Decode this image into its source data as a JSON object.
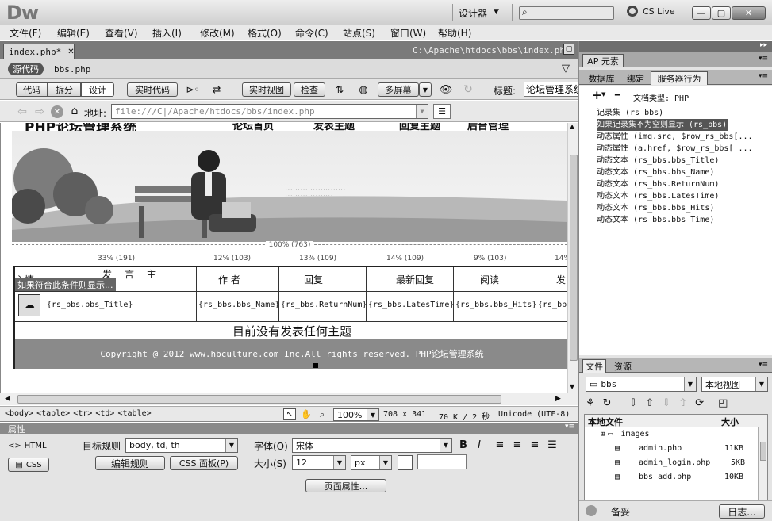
{
  "app": {
    "logo": "Dw",
    "workspace": "设计器",
    "brand": "CS Live"
  },
  "menu": [
    "文件(F)",
    "编辑(E)",
    "查看(V)",
    "插入(I)",
    "修改(M)",
    "格式(O)",
    "命令(C)",
    "站点(S)",
    "窗口(W)",
    "帮助(H)"
  ],
  "doc": {
    "tab_name": "index.php*",
    "path": "C:\\Apache\\htdocs\\bbs\\index.php",
    "source_label": "源代码",
    "related_file": "bbs.php",
    "address_label": "地址:",
    "address": "file:///C|/Apache/htdocs/bbs/index.php"
  },
  "toolbar": {
    "code": "代码",
    "split": "拆分",
    "design": "设计",
    "live_code": "实时代码",
    "live_view": "实时视图",
    "inspect": "检查",
    "multiscreen": "多屏幕",
    "title_label": "标题:",
    "title_value": "论坛管理系统"
  },
  "page": {
    "header_title": "PHP论坛管理系统",
    "nav": [
      "论坛首页",
      "发表主题",
      "回复主题",
      "后台管理"
    ],
    "width_label": "100% (763)",
    "col_widths": [
      "33% (191)",
      "12% (103)",
      "13% (109)",
      "14% (109)",
      "9% (103)",
      "14%"
    ],
    "header_cells": [
      "心情",
      "发 言 主",
      "作 者",
      "回复",
      "最新回复",
      "阅读",
      "发"
    ],
    "tooltip": "如果符合此条件则显示...",
    "row": [
      "{rs_bbs.bbs_Title}",
      "{rs_bbs.bbs_Name}",
      "{rs_bbs.ReturnNum}",
      "{rs_bbs.LatesTime}",
      "{rs_bbs.bbs_Hits}",
      "{rs_bbs."
    ],
    "empty_msg": "目前没有发表任何主题",
    "copyright": "Copyright @ 2012 www.hbculture.com Inc.All rights reserved. PHP论坛管理系统"
  },
  "statusbar": {
    "tags": [
      "<body>",
      "<table>",
      "<tr>",
      "<td>",
      "<table>"
    ],
    "zoom": "100%",
    "size": "708 x 341",
    "filesize": "70 K / 2 秒",
    "encoding": "Unicode (UTF-8)"
  },
  "properties": {
    "title": "属性",
    "html": "HTML",
    "css": "CSS",
    "target_rule_label": "目标规则",
    "target_rule": "body, td, th",
    "edit_rule": "编辑规则",
    "css_panel": "CSS 面板(P)",
    "font_label": "字体(O)",
    "font_value": "宋体",
    "size_label": "大小(S)",
    "size_value": "12",
    "unit": "px",
    "page_props": "页面属性..."
  },
  "right_panel": {
    "ap_tab": "AP 元素",
    "tabs": [
      "数据库",
      "绑定",
      "服务器行为"
    ],
    "doc_type": "文档类型: PHP",
    "behaviors": [
      "记录集 (rs_bbs)",
      "如果记录集不为空则显示 (rs_bbs)",
      "动态属性 (img.src, $row_rs_bbs[...",
      "动态属性 (a.href, $row_rs_bbs['...",
      "动态文本 (rs_bbs.bbs_Title)",
      "动态文本 (rs_bbs.bbs_Name)",
      "动态文本 (rs_bbs.ReturnNum)",
      "动态文本 (rs_bbs.LatesTime)",
      "动态文本 (rs_bbs.bbs_Hits)",
      "动态文本 (rs_bbs.bbs_Time)"
    ],
    "files_tabs": [
      "文件",
      "资源"
    ],
    "site": "bbs",
    "view": "本地视图",
    "col_local": "本地文件",
    "col_size": "大小",
    "files": [
      {
        "name": "images",
        "size": ""
      },
      {
        "name": "admin.php",
        "size": "11KB"
      },
      {
        "name": "admin_login.php",
        "size": "5KB"
      },
      {
        "name": "bbs_add.php",
        "size": "10KB"
      }
    ],
    "footer_status": "备妥",
    "log": "日志..."
  },
  "colors": {
    "chrome": "#d4d4d4",
    "dark": "#6c6c6c",
    "selected": "#555555"
  }
}
